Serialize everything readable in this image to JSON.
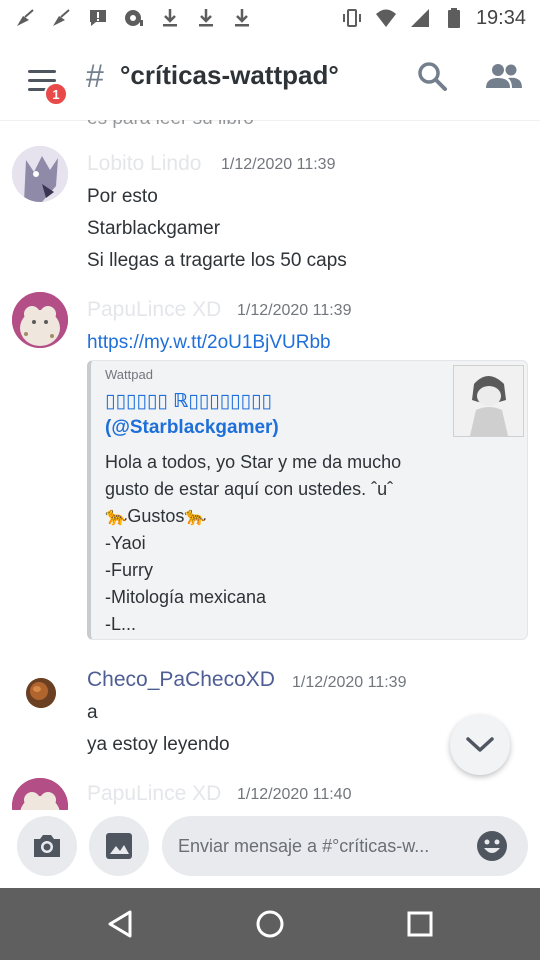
{
  "status_bar": {
    "time": "19:34",
    "notification_icons": [
      "sweep-icon",
      "sweep-icon",
      "chat-alert-icon",
      "game-controller-icon",
      "download-icon",
      "download-icon",
      "download-icon"
    ],
    "system_icons": [
      "vibrate-icon",
      "wifi-icon",
      "signal-icon",
      "battery-icon"
    ]
  },
  "header": {
    "badge_count": "1",
    "hash": "#",
    "channel_name": "°críticas-wattpad°"
  },
  "messages": {
    "cutoff_text": "es para leer su libro",
    "list": [
      {
        "author": "Lobito Lindo",
        "timestamp": "1/12/2020 11:39",
        "lines": [
          "Por esto",
          "Starblackgamer",
          "Si llegas a tragarte los 50 caps"
        ]
      },
      {
        "author": "PapuLince XD",
        "timestamp": "1/12/2020 11:39",
        "link": "https://my.w.tt/2oU1BjVURbb",
        "embed": {
          "provider": "Wattpad",
          "title_line1": "▯▯▯▯▯▯ ℝ▯▯▯▯▯▯▯▯",
          "title_line2": "(@Starblackgamer)",
          "description": [
            "Hola a todos, yo Star y me da mucho",
            "gusto de estar aquí con ustedes. ˆuˆ",
            "  🐆Gustos🐆",
            "  -Yaoi",
            "  -Furry",
            "  -Mitología mexicana",
            "  -L..."
          ]
        }
      },
      {
        "author": "Checo_PaChecoXD",
        "timestamp": "1/12/2020 11:39",
        "lines": [
          "a",
          "ya estoy leyendo"
        ]
      },
      {
        "author": "PapuLince XD",
        "timestamp": "1/12/2020 11:40"
      }
    ]
  },
  "composer": {
    "placeholder": "Enviar mensaje a #°críticas-w...",
    "value": ""
  },
  "colors": {
    "link": "#1e6fd9",
    "badge": "#e84a4a",
    "author": "#4f5d95",
    "navbar": "#5f5f5f"
  }
}
